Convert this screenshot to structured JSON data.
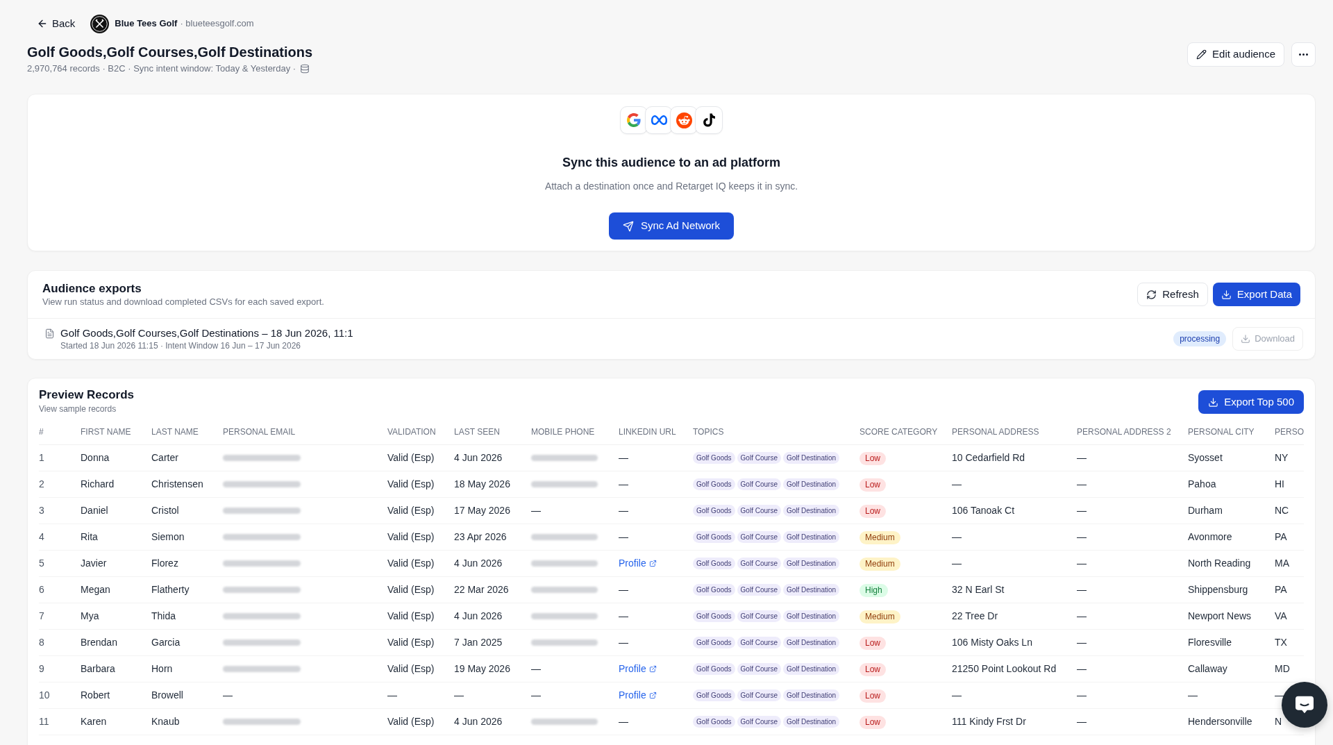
{
  "header": {
    "back_label": "Back",
    "brand_name": "Blue Tees Golf",
    "brand_domain": "· blueteesgolf.com"
  },
  "audience": {
    "title": "Golf Goods,Golf Courses,Golf Destinations",
    "meta": "2,970,764 records · B2C · Sync intent window: Today & Yesterday ·",
    "edit_label": "Edit audience"
  },
  "sync_card": {
    "title": "Sync this audience to an ad platform",
    "description": "Attach a destination once and Retarget IQ keeps it in sync.",
    "button_label": "Sync Ad Network"
  },
  "exports": {
    "title": "Audience exports",
    "description": "View run status and download completed CSVs for each saved export.",
    "refresh_label": "Refresh",
    "export_label": "Export Data",
    "items": [
      {
        "title": "Golf Goods,Golf Courses,Golf Destinations – 18 Jun 2026, 11:1",
        "subtitle": "Started 18 Jun 2026 11:15 · Intent Window 16 Jun – 17 Jun 2026",
        "status": "processing",
        "download_label": "Download",
        "download_disabled": true
      }
    ]
  },
  "preview": {
    "title": "Preview Records",
    "subtitle": "View sample records",
    "export_label": "Export Top 500",
    "table": {
      "columns": [
        "#",
        "FIRST NAME",
        "LAST NAME",
        "PERSONAL EMAIL",
        "VALIDATION",
        "LAST SEEN",
        "MOBILE PHONE",
        "LINKEDIN URL",
        "TOPICS",
        "SCORE CATEGORY",
        "PERSONAL ADDRESS",
        "PERSONAL ADDRESS 2",
        "PERSONAL CITY",
        "PERSO"
      ],
      "rows": [
        {
          "number": "1",
          "first_name": "Donna",
          "last_name": "Carter",
          "personal_email": {
            "kind": "blurred"
          },
          "validation": "Valid (Esp)",
          "last_seen": "4 Jun 2026",
          "mobile_phone": {
            "kind": "blurred"
          },
          "linkedin_url": {
            "kind": "text",
            "text": "—"
          },
          "topics": [
            "Golf Goods",
            "Golf Course",
            "Golf Destination"
          ],
          "score_category": {
            "text": "Low",
            "color": "#fee2e2"
          },
          "personal_address": "10 Cedarfield Rd",
          "personal_address_2": "—",
          "personal_city": "Syosset",
          "column_14": "NY"
        },
        {
          "number": "2",
          "first_name": "Richard",
          "last_name": "Christensen",
          "personal_email": {
            "kind": "blurred"
          },
          "validation": "Valid (Esp)",
          "last_seen": "18 May 2026",
          "mobile_phone": {
            "kind": "blurred"
          },
          "linkedin_url": {
            "kind": "text",
            "text": "—"
          },
          "topics": [
            "Golf Goods",
            "Golf Course",
            "Golf Destination"
          ],
          "score_category": {
            "text": "Low",
            "color": "#fee2e2"
          },
          "personal_address": "—",
          "personal_address_2": "—",
          "personal_city": "Pahoa",
          "column_14": "HI"
        },
        {
          "number": "3",
          "first_name": "Daniel",
          "last_name": "Cristol",
          "personal_email": {
            "kind": "blurred"
          },
          "validation": "Valid (Esp)",
          "last_seen": "17 May 2026",
          "mobile_phone": {
            "kind": "text",
            "text": "—"
          },
          "linkedin_url": {
            "kind": "text",
            "text": "—"
          },
          "topics": [
            "Golf Goods",
            "Golf Course",
            "Golf Destination"
          ],
          "score_category": {
            "text": "Low",
            "color": "#fee2e2"
          },
          "personal_address": "106 Tanoak Ct",
          "personal_address_2": "—",
          "personal_city": "Durham",
          "column_14": "NC"
        },
        {
          "number": "4",
          "first_name": "Rita",
          "last_name": "Siemon",
          "personal_email": {
            "kind": "blurred"
          },
          "validation": "Valid (Esp)",
          "last_seen": "23 Apr 2026",
          "mobile_phone": {
            "kind": "blurred"
          },
          "linkedin_url": {
            "kind": "text",
            "text": "—"
          },
          "topics": [
            "Golf Goods",
            "Golf Course",
            "Golf Destination"
          ],
          "score_category": {
            "text": "Medium",
            "color": "#fef3c7"
          },
          "personal_address": "—",
          "personal_address_2": "—",
          "personal_city": "Avonmore",
          "column_14": "PA"
        },
        {
          "number": "5",
          "first_name": "Javier",
          "last_name": "Florez",
          "personal_email": {
            "kind": "blurred"
          },
          "validation": "Valid (Esp)",
          "last_seen": "4 Jun 2026",
          "mobile_phone": {
            "kind": "blurred"
          },
          "linkedin_url": {
            "kind": "link",
            "text": "Profile"
          },
          "topics": [
            "Golf Goods",
            "Golf Course",
            "Golf Destination"
          ],
          "score_category": {
            "text": "Medium",
            "color": "#fef3c7"
          },
          "personal_address": "—",
          "personal_address_2": "—",
          "personal_city": "North Reading",
          "column_14": "MA"
        },
        {
          "number": "6",
          "first_name": "Megan",
          "last_name": "Flatherty",
          "personal_email": {
            "kind": "blurred"
          },
          "validation": "Valid (Esp)",
          "last_seen": "22 Mar 2026",
          "mobile_phone": {
            "kind": "blurred"
          },
          "linkedin_url": {
            "kind": "text",
            "text": "—"
          },
          "topics": [
            "Golf Goods",
            "Golf Course",
            "Golf Destination"
          ],
          "score_category": {
            "text": "High",
            "color": "#dcfce7"
          },
          "personal_address": "32 N Earl St",
          "personal_address_2": "—",
          "personal_city": "Shippensburg",
          "column_14": "PA"
        },
        {
          "number": "7",
          "first_name": "Mya",
          "last_name": "Thida",
          "personal_email": {
            "kind": "blurred"
          },
          "validation": "Valid (Esp)",
          "last_seen": "4 Jun 2026",
          "mobile_phone": {
            "kind": "blurred"
          },
          "linkedin_url": {
            "kind": "text",
            "text": "—"
          },
          "topics": [
            "Golf Goods",
            "Golf Course",
            "Golf Destination"
          ],
          "score_category": {
            "text": "Medium",
            "color": "#fef3c7"
          },
          "personal_address": "22 Tree Dr",
          "personal_address_2": "—",
          "personal_city": "Newport News",
          "column_14": "VA"
        },
        {
          "number": "8",
          "first_name": "Brendan",
          "last_name": "Garcia",
          "personal_email": {
            "kind": "blurred"
          },
          "validation": "Valid (Esp)",
          "last_seen": "7 Jan 2025",
          "mobile_phone": {
            "kind": "blurred"
          },
          "linkedin_url": {
            "kind": "text",
            "text": "—"
          },
          "topics": [
            "Golf Goods",
            "Golf Course",
            "Golf Destination"
          ],
          "score_category": {
            "text": "Low",
            "color": "#fee2e2"
          },
          "personal_address": "106 Misty Oaks Ln",
          "personal_address_2": "—",
          "personal_city": "Floresville",
          "column_14": "TX"
        },
        {
          "number": "9",
          "first_name": "Barbara",
          "last_name": "Horn",
          "personal_email": {
            "kind": "blurred"
          },
          "validation": "Valid (Esp)",
          "last_seen": "19 May 2026",
          "mobile_phone": {
            "kind": "text",
            "text": "—"
          },
          "linkedin_url": {
            "kind": "link",
            "text": "Profile"
          },
          "topics": [
            "Golf Goods",
            "Golf Course",
            "Golf Destination"
          ],
          "score_category": {
            "text": "Low",
            "color": "#fee2e2"
          },
          "personal_address": "21250 Point Lookout Rd",
          "personal_address_2": "—",
          "personal_city": "Callaway",
          "column_14": "MD"
        },
        {
          "number": "10",
          "first_name": "Robert",
          "last_name": "Browell",
          "personal_email": {
            "kind": "text",
            "text": "—"
          },
          "validation": "—",
          "last_seen": "—",
          "mobile_phone": {
            "kind": "text",
            "text": "—"
          },
          "linkedin_url": {
            "kind": "link",
            "text": "Profile"
          },
          "topics": [
            "Golf Goods",
            "Golf Course",
            "Golf Destination"
          ],
          "score_category": {
            "text": "Low",
            "color": "#fee2e2"
          },
          "personal_address": "—",
          "personal_address_2": "—",
          "personal_city": "—",
          "column_14": "—"
        },
        {
          "number": "11",
          "first_name": "Karen",
          "last_name": "Knaub",
          "personal_email": {
            "kind": "blurred"
          },
          "validation": "Valid (Esp)",
          "last_seen": "4 Jun 2026",
          "mobile_phone": {
            "kind": "blurred"
          },
          "linkedin_url": {
            "kind": "text",
            "text": "—"
          },
          "topics": [
            "Golf Goods",
            "Golf Course",
            "Golf Destination"
          ],
          "score_category": {
            "text": "Low",
            "color": "#fee2e2"
          },
          "personal_address": "111 Kindy Frst Dr",
          "personal_address_2": "—",
          "personal_city": "Hendersonville",
          "column_14": "N"
        }
      ]
    }
  }
}
